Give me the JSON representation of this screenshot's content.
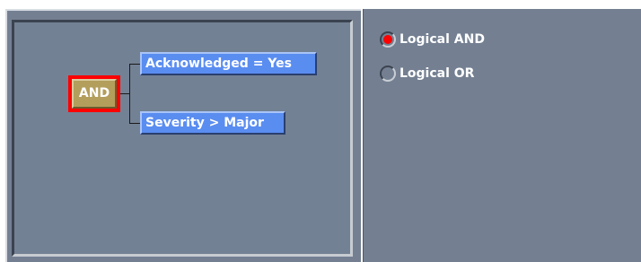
{
  "tree": {
    "operator_label": "AND",
    "conditions": [
      {
        "label": "Acknowledged = Yes"
      },
      {
        "label": "Severity > Major"
      }
    ]
  },
  "options": {
    "items": [
      {
        "label": "Logical AND",
        "selected": true
      },
      {
        "label": "Logical OR",
        "selected": false
      }
    ]
  },
  "colors": {
    "panel_bg": "#748092",
    "operator_bg": "#b39e5c",
    "selection_border": "#ff0000",
    "condition_bg": "#5a8df0",
    "radio_selected": "#ff0000"
  }
}
